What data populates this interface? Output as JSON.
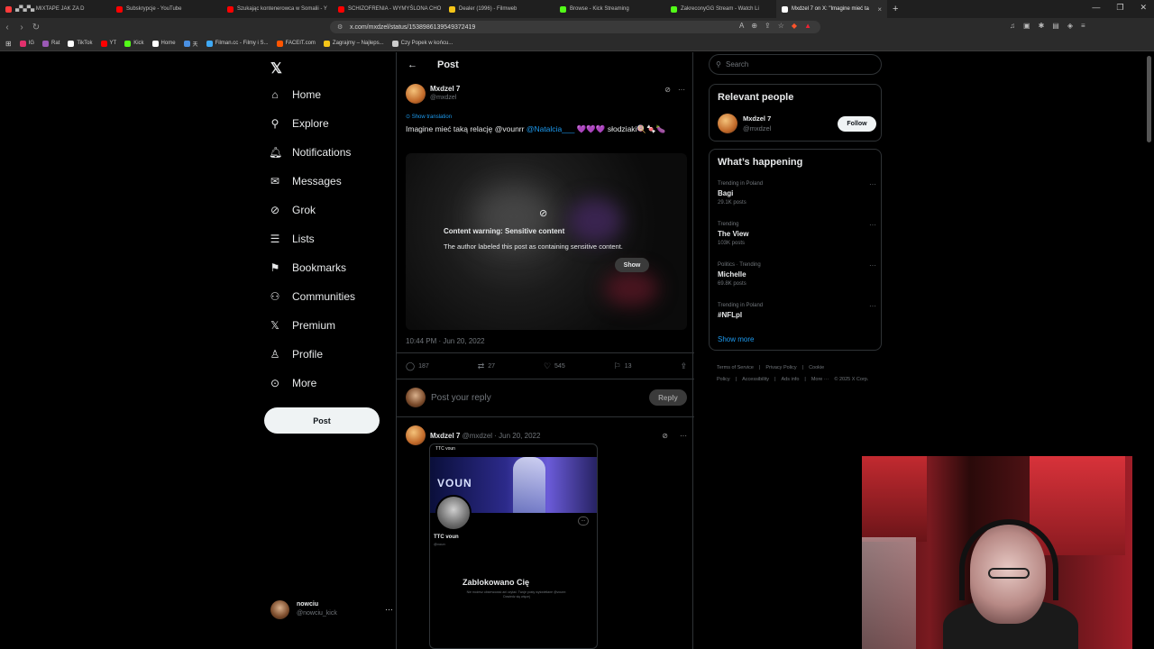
{
  "browser": {
    "tabs": [
      {
        "label": "▄▀▄▀▄ MIXTAPE JAK ZA D",
        "color": "#ff3b3b"
      },
      {
        "label": "Subskrypcje - YouTube",
        "color": "#ff0000"
      },
      {
        "label": "Szukając kontenerowca w Somalii - Y",
        "color": "#ff0000"
      },
      {
        "label": "SCHIZOFRENIA - WYMYŚLONA CHO",
        "color": "#ff0000"
      },
      {
        "label": "Dealer (1996) - Filmweb",
        "color": "#f5c518"
      },
      {
        "label": "Browse - Kick Streaming",
        "color": "#53fc18"
      },
      {
        "label": "ZakreconyGG Stream - Watch Li",
        "color": "#53fc18"
      },
      {
        "label": "Mxdzel 7 on X: \"Imagine mieć ta",
        "color": "#ffffff",
        "active": true
      }
    ],
    "url": "x.com/mxdzel/status/1538986139549372419",
    "bookmarks": [
      {
        "label": "IG",
        "color": "#e1306c"
      },
      {
        "label": "Rat",
        "color": "#9b59b6"
      },
      {
        "label": "TikTok",
        "color": "#ffffff"
      },
      {
        "label": "YT",
        "color": "#ff0000"
      },
      {
        "label": "Kick",
        "color": "#53fc18"
      },
      {
        "label": "Home",
        "color": "#ffffff"
      },
      {
        "label": "天",
        "color": "#4a90e2"
      },
      {
        "label": "Filman.cc - Filmy i S...",
        "color": "#3fa9f5"
      },
      {
        "label": "FACEIT.com",
        "color": "#ff5500"
      },
      {
        "label": "Zagrajmy – Najleps...",
        "color": "#f5c518"
      },
      {
        "label": "Czy Popek w końcu...",
        "color": "#cccccc"
      }
    ]
  },
  "nav": {
    "logo": "𝕏",
    "items": [
      {
        "label": "Home",
        "icon": "⌂",
        "name": "home"
      },
      {
        "label": "Explore",
        "icon": "⚲",
        "name": "explore"
      },
      {
        "label": "Notifications",
        "icon": "🔔︎",
        "name": "notifications"
      },
      {
        "label": "Messages",
        "icon": "✉",
        "name": "messages"
      },
      {
        "label": "Grok",
        "icon": "⊘",
        "name": "grok"
      },
      {
        "label": "Lists",
        "icon": "☰",
        "name": "lists"
      },
      {
        "label": "Bookmarks",
        "icon": "⚑",
        "name": "bookmarks"
      },
      {
        "label": "Communities",
        "icon": "⚇",
        "name": "communities"
      },
      {
        "label": "Premium",
        "icon": "𝕏",
        "name": "premium"
      },
      {
        "label": "Profile",
        "icon": "♙",
        "name": "profile"
      },
      {
        "label": "More",
        "icon": "⊙",
        "name": "more"
      }
    ],
    "post_button": "Post",
    "account": {
      "name": "nowciu",
      "handle": "@nowciu_kick"
    }
  },
  "header": {
    "back": "←",
    "title": "Post"
  },
  "post": {
    "author_name": "Mxdzel 7",
    "author_handle": "@mxdzel",
    "show_translation": "Show translation",
    "text_before": "Imagine mieć taką relację @vounrr ",
    "mention": "@Natalcia___",
    "text_after": " 💜💜💜 słodziaki🍭🍬🍆",
    "warning_title": "Content warning: Sensitive content",
    "warning_text": "The author labeled this post as containing sensitive content.",
    "warning_show": "Show",
    "timestamp": "10:44 PM · Jun 20, 2022",
    "replies": "187",
    "reposts": "27",
    "likes": "545",
    "bookmarks": "13",
    "reply_placeholder": "Post your reply",
    "reply_button": "Reply"
  },
  "post2": {
    "author_name": "Mxdzel 7",
    "meta": "@mxdzel · Jun 20, 2022",
    "embed": {
      "top": "TTC voun",
      "banner": "VOUN",
      "name": "TTC voun",
      "handle": "@voun",
      "blocked": "Zablokowano Cię",
      "small": "Nie możesz obserwować ani czytać. Twoje posty wyświetlane @vounrr. Dowiedz się więcej"
    }
  },
  "sidebar": {
    "search_placeholder": "Search",
    "relevant_title": "Relevant people",
    "relevant": {
      "name": "Mxdzel 7",
      "handle": "@mxdzel",
      "follow": "Follow"
    },
    "happening_title": "What’s happening",
    "trends": [
      {
        "category": "Trending in Poland",
        "name": "Bagi",
        "count": "29.1K posts"
      },
      {
        "category": "Trending",
        "name": "The View",
        "count": "103K posts"
      },
      {
        "category": "Politics · Trending",
        "name": "Michelle",
        "count": "69.8K posts"
      },
      {
        "category": "Trending in Poland",
        "name": "#NFLpl",
        "count": ""
      }
    ],
    "show_more": "Show more",
    "footer": [
      "Terms of Service",
      "|",
      "Privacy Policy",
      "|",
      "Cookie Policy",
      "|",
      "Accessibility",
      "|",
      "Ads info",
      "|",
      "More ···",
      "© 2025 X Corp."
    ]
  }
}
